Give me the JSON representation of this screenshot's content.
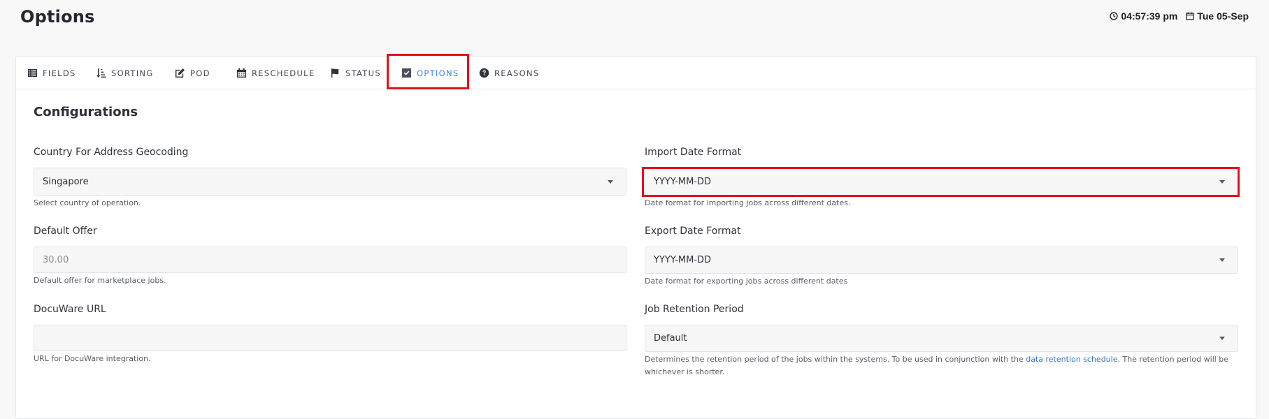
{
  "header": {
    "title": "Options",
    "time": "04:57:39 pm",
    "date": "Tue 05-Sep"
  },
  "tabs": [
    {
      "label": "FIELDS",
      "icon": "list-icon"
    },
    {
      "label": "SORTING",
      "icon": "sort-icon"
    },
    {
      "label": "POD",
      "icon": "edit-icon"
    },
    {
      "label": "RESCHEDULE",
      "icon": "calendar-icon"
    },
    {
      "label": "STATUS",
      "icon": "flag-icon"
    },
    {
      "label": "OPTIONS",
      "icon": "checkbox-icon",
      "active": true
    },
    {
      "label": "REASONS",
      "icon": "question-circle-icon"
    }
  ],
  "section": {
    "title": "Configurations"
  },
  "fields": {
    "country": {
      "label": "Country For Address Geocoding",
      "value": "Singapore",
      "help": "Select country of operation."
    },
    "default_offer": {
      "label": "Default Offer",
      "value": "30.00",
      "help": "Default offer for marketplace jobs."
    },
    "docuware_url": {
      "label": "DocuWare URL",
      "value": "",
      "help": "URL for DocuWare integration."
    },
    "import_date_format": {
      "label": "Import Date Format",
      "value": "YYYY-MM-DD",
      "help": "Date format for importing jobs across different dates."
    },
    "export_date_format": {
      "label": "Export Date Format",
      "value": "YYYY-MM-DD",
      "help": "Date format for exporting jobs across different dates"
    },
    "job_retention": {
      "label": "Job Retention Period",
      "value": "Default",
      "help_before": "Determines the retention period of the jobs within the systems. To be used in conjunction with the ",
      "help_link": "data retention schedule",
      "help_after": ". The retention period will be whichever is shorter."
    }
  },
  "colors": {
    "accent": "#3a86e8",
    "highlight": "#e1121a",
    "link": "#3a73c4"
  }
}
